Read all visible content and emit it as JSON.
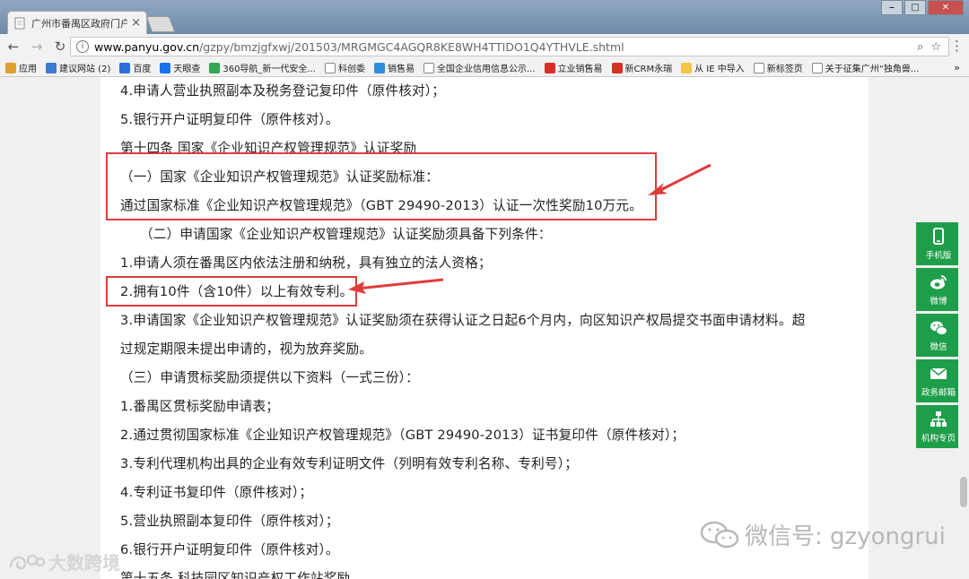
{
  "browser": {
    "tab_title": "广州市番禺区政府门户网",
    "tab_close": "×",
    "url_host": "www.panyu.gov.cn",
    "url_path": "/gzpy/bmzjgfxwj/201503/MRGMGC4AGQR8KE8WH4TTIDO1Q4YTHVLE.shtml",
    "window_controls": [
      "⎯",
      "□",
      "✕"
    ]
  },
  "bookmarks": [
    {
      "label": "应用",
      "color": "#e0a030"
    },
    {
      "label": "建议网站 (2)",
      "color": "#3b7bd4"
    },
    {
      "label": "百度",
      "color": "#2f6ed8"
    },
    {
      "label": "天眼查",
      "color": "#1a73e8"
    },
    {
      "label": "360导航_新一代安全...",
      "color": "#34a853"
    },
    {
      "label": "科创委",
      "color": "#ffffff"
    },
    {
      "label": "销售易",
      "color": "#2f8de0"
    },
    {
      "label": "全国企业信用信息公示...",
      "color": "#ffffff"
    },
    {
      "label": "立业销售易",
      "color": "#d93025"
    },
    {
      "label": "新CRM永瑞",
      "color": "#d93025"
    },
    {
      "label": "从 IE 中导入",
      "color": "#f4c542"
    },
    {
      "label": "新标签页",
      "color": "#ffffff"
    },
    {
      "label": "关于征集广州“独角兽...",
      "color": "#ffffff"
    }
  ],
  "bookmarks_more": "»",
  "article": {
    "lines": [
      "4.申请人营业执照副本及税务登记复印件（原件核对）；",
      "5.银行开户证明复印件（原件核对）。",
      "第十四条 国家《企业知识产权管理规范》认证奖励",
      "（一）国家《企业知识产权管理规范》认证奖励标准：",
      "通过国家标准《企业知识产权管理规范》（GBT 29490-2013）认证一次性奖励10万元。",
      "（二）申请国家《企业知识产权管理规范》认证奖励须具备下列条件：",
      "1.申请人须在番禺区内依法注册和纳税，具有独立的法人资格；",
      "2.拥有10件（含10件）以上有效专利。",
      "3.申请国家《企业知识产权管理规范》认证奖励须在获得认证之日起6个月内，向区知识产权局提交书面申请材料。超",
      "过规定期限未提出申请的，视为放弃奖励。",
      "（三）申请贯标奖励须提供以下资料（一式三份）：",
      "1.番禺区贯标奖励申请表；",
      "2.通过贯彻国家标准《企业知识产权管理规范》（GBT 29490-2013）证书复印件（原件核对）；",
      "3.专利代理机构出具的企业有效专利证明文件（列明有效专利名称、专利号）；",
      "4.专利证书复印件（原件核对）；",
      "5.营业执照副本复印件（原件核对）；",
      "6.银行开户证明复印件（原件核对）。",
      "第十五条 科技园区知识产权工作站奖励"
    ]
  },
  "side_panel": [
    {
      "label": "手机版",
      "icon": "mobile-icon"
    },
    {
      "label": "微博",
      "icon": "weibo-icon"
    },
    {
      "label": "微信",
      "icon": "wechat-icon"
    },
    {
      "label": "政务邮箱",
      "icon": "mail-icon"
    },
    {
      "label": "机构专页",
      "icon": "org-chart-icon"
    }
  ],
  "watermarks": {
    "right": "微信号: gzyongrui",
    "left": "大数跨境"
  },
  "colors": {
    "highlight_red": "#e03c3c",
    "side_green": "#1e9e4a"
  }
}
